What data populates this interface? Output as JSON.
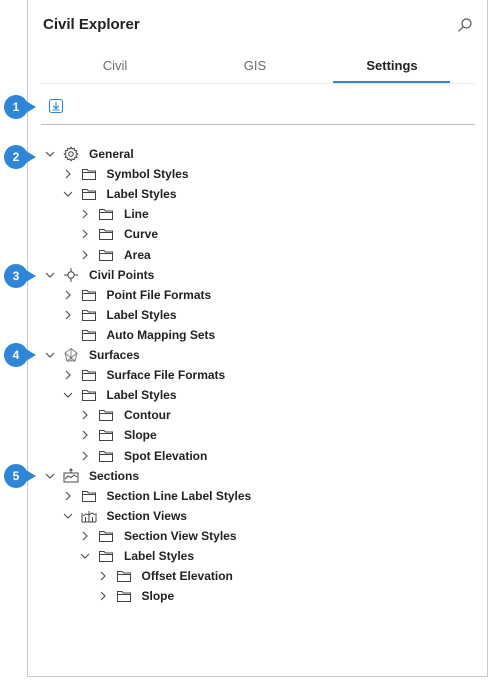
{
  "header": {
    "title": "Civil Explorer"
  },
  "tabs": [
    {
      "label": "Civil",
      "active": false
    },
    {
      "label": "GIS",
      "active": false
    },
    {
      "label": "Settings",
      "active": true
    }
  ],
  "badges": [
    "1",
    "2",
    "3",
    "4",
    "5"
  ],
  "tree": [
    {
      "label": "General",
      "icon": "gear-icon",
      "expanded": true
    },
    {
      "label": "Symbol Styles",
      "icon": "folder-icon",
      "expanded": false
    },
    {
      "label": "Label Styles",
      "icon": "folder-icon",
      "expanded": true
    },
    {
      "label": "Line",
      "icon": "folder-icon",
      "expanded": false
    },
    {
      "label": "Curve",
      "icon": "folder-icon",
      "expanded": false
    },
    {
      "label": "Area",
      "icon": "folder-icon",
      "expanded": false
    },
    {
      "label": "Civil Points",
      "icon": "civil-point-icon",
      "expanded": true
    },
    {
      "label": "Point File Formats",
      "icon": "folder-icon",
      "expanded": false
    },
    {
      "label": "Label Styles",
      "icon": "folder-icon",
      "expanded": false
    },
    {
      "label": "Auto Mapping Sets",
      "icon": "folder-icon",
      "expanded": null
    },
    {
      "label": "Surfaces",
      "icon": "surface-icon",
      "expanded": true
    },
    {
      "label": "Surface File Formats",
      "icon": "folder-icon",
      "expanded": false
    },
    {
      "label": "Label Styles",
      "icon": "folder-icon",
      "expanded": true
    },
    {
      "label": "Contour",
      "icon": "folder-icon",
      "expanded": false
    },
    {
      "label": "Slope",
      "icon": "folder-icon",
      "expanded": false
    },
    {
      "label": "Spot Elevation",
      "icon": "folder-icon",
      "expanded": false
    },
    {
      "label": "Sections",
      "icon": "section-icon",
      "expanded": true
    },
    {
      "label": "Section Line Label Styles",
      "icon": "folder-icon",
      "expanded": false
    },
    {
      "label": "Section Views",
      "icon": "section-view-icon",
      "expanded": true
    },
    {
      "label": "Section View Styles",
      "icon": "folder-icon",
      "expanded": false
    },
    {
      "label": "Label Styles",
      "icon": "folder-icon",
      "expanded": true
    },
    {
      "label": "Offset Elevation",
      "icon": "folder-icon",
      "expanded": false
    },
    {
      "label": "Slope",
      "icon": "folder-icon",
      "expanded": false
    }
  ],
  "colors": {
    "accent": "#2f86d6",
    "border": "#c9c9c9"
  }
}
